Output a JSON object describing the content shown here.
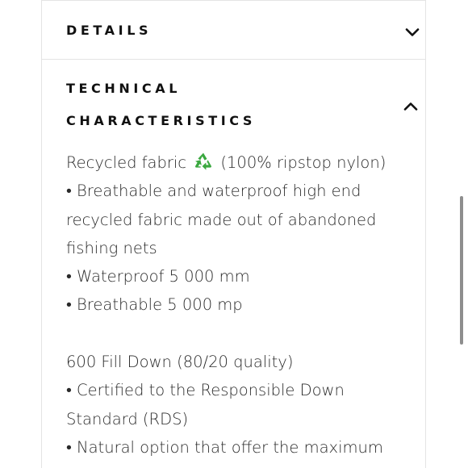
{
  "details": {
    "title": "DETAILS",
    "chevron_icon": "chevron-down-icon"
  },
  "technical": {
    "title_line1": "TECHNICAL",
    "title_line2": "CHARACTERISTICS",
    "chevron_icon": "chevron-up-icon"
  },
  "content": {
    "line_fabric_before": "Recycled fabric",
    "recycle_icon": "recycle-icon",
    "line_fabric_after": "(100% ripstop nylon)",
    "line_2": "• Breathable and waterproof high end",
    "line_3": "recycled fabric made out of abandoned",
    "line_4": "fishing nets",
    "line_5": "• Waterproof 5 000 mm",
    "line_6": "• Breathable 5 000 mp",
    "line_7": "600 Fill Down (80/20 quality)",
    "line_8": "• Certified to the Responsible Down",
    "line_9": "Standard (RDS)",
    "line_10": "• Natural option that offer the maximum"
  },
  "colors": {
    "border": "#e4e4e4",
    "heading": "#111111",
    "body_text": "#2a2a2a",
    "recycle_green": "#3aa83f",
    "scrollbar": "#8e8e8e"
  }
}
